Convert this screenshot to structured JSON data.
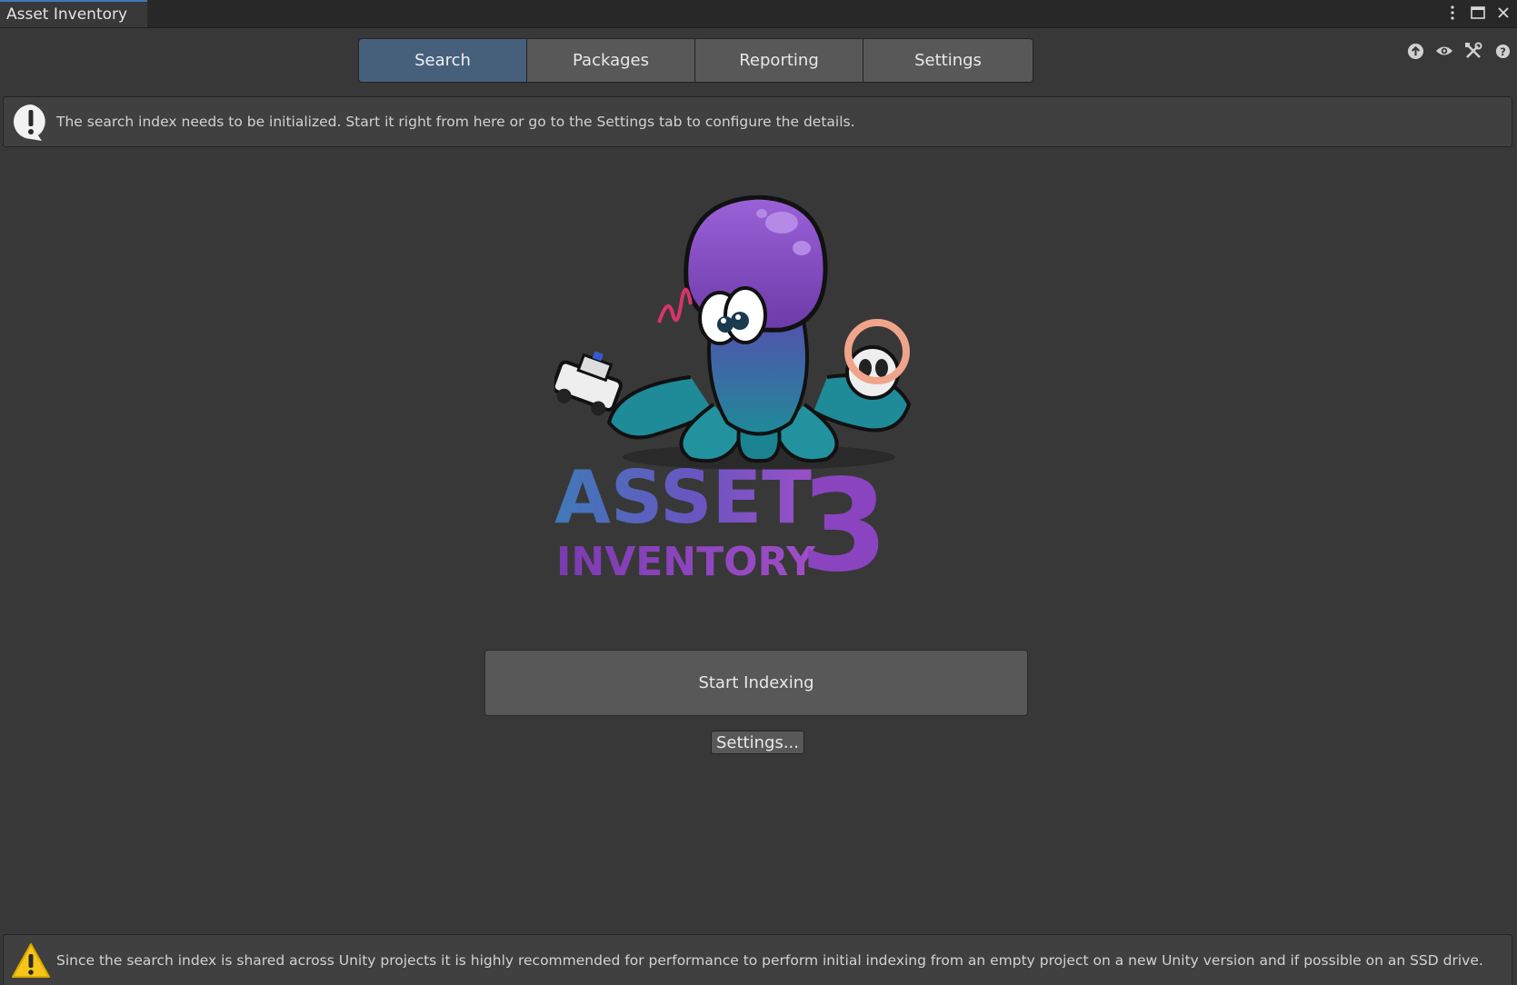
{
  "window": {
    "title": "Asset Inventory",
    "controls": [
      "more-options-icon",
      "maximize-icon",
      "close-icon"
    ]
  },
  "tabs": [
    {
      "label": "Search",
      "active": true
    },
    {
      "label": "Packages",
      "active": false
    },
    {
      "label": "Reporting",
      "active": false
    },
    {
      "label": "Settings",
      "active": false
    }
  ],
  "toolbar_icons": [
    "upload-icon",
    "eye-icon",
    "tools-icon",
    "help-icon"
  ],
  "info_box": {
    "icon": "info-exclamation-icon",
    "text": "The search index needs to be initialized. Start it right from here or go to the Settings tab to configure the details."
  },
  "logo": {
    "line1": "ASSET",
    "line2": "INVENTORY",
    "version": "3"
  },
  "actions": {
    "start_indexing": "Start Indexing",
    "settings": "Settings..."
  },
  "warning_box": {
    "icon": "warning-triangle-icon",
    "text": "Since the search index is shared across Unity projects it is highly recommended for performance to perform initial indexing from an empty project on a new Unity version and if possible on an SSD drive."
  },
  "colors": {
    "background": "#383838",
    "active_tab": "#46607c",
    "accent_purple": "#8a4fc8",
    "accent_teal": "#2a8a9a",
    "warning": "#f5c518"
  }
}
